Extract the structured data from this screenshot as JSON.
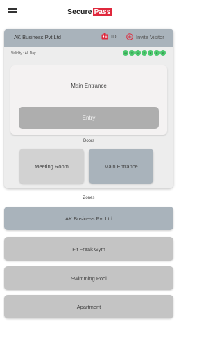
{
  "app": {
    "logo_secure": "Secure",
    "logo_pass": "Pass",
    "accent": "#e0283c"
  },
  "card": {
    "company": "AK Business Pvt Ltd",
    "id_label": "ID",
    "invite_label": "Invite Visitor",
    "validity": "Validity : All Day",
    "days": [
      "M",
      "T",
      "W",
      "T",
      "F",
      "S",
      "S"
    ],
    "entrance_title": "Main Entrance",
    "entry_label": "Entry",
    "doors_label": "Doors",
    "doors": [
      "Meeting Room",
      "Main Entrance"
    ]
  },
  "zones_label": "Zones",
  "zones": [
    "AK Business Pvt Ltd",
    "Fit Freak Gym",
    "Swimming Pool",
    "Apartment"
  ]
}
